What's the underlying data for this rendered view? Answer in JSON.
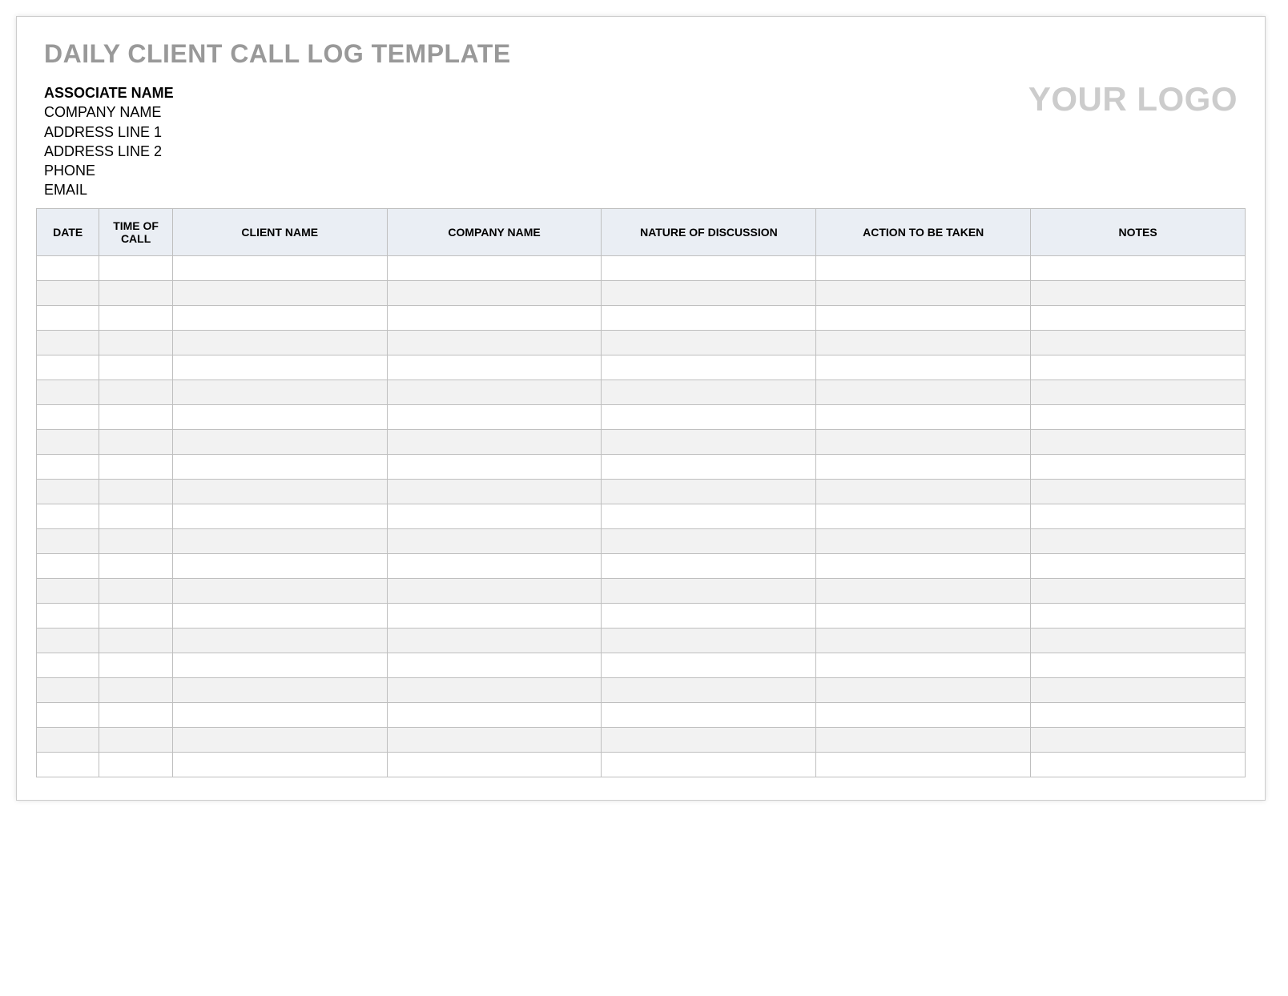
{
  "title": "DAILY CLIENT CALL LOG TEMPLATE",
  "header": {
    "associate_name": "ASSOCIATE NAME",
    "company_name": "COMPANY NAME",
    "address_line_1": "ADDRESS LINE 1",
    "address_line_2": "ADDRESS LINE 2",
    "phone": "PHONE",
    "email": "EMAIL",
    "logo_text": "YOUR LOGO"
  },
  "table": {
    "columns": {
      "date": "DATE",
      "time_of_call": "TIME OF CALL",
      "client_name": "CLIENT NAME",
      "company_name": "COMPANY NAME",
      "nature_of_discussion": "NATURE OF DISCUSSION",
      "action_to_be_taken": "ACTION TO BE TAKEN",
      "notes": "NOTES"
    },
    "rows": [
      {
        "date": "",
        "time_of_call": "",
        "client_name": "",
        "company_name": "",
        "nature_of_discussion": "",
        "action_to_be_taken": "",
        "notes": ""
      },
      {
        "date": "",
        "time_of_call": "",
        "client_name": "",
        "company_name": "",
        "nature_of_discussion": "",
        "action_to_be_taken": "",
        "notes": ""
      },
      {
        "date": "",
        "time_of_call": "",
        "client_name": "",
        "company_name": "",
        "nature_of_discussion": "",
        "action_to_be_taken": "",
        "notes": ""
      },
      {
        "date": "",
        "time_of_call": "",
        "client_name": "",
        "company_name": "",
        "nature_of_discussion": "",
        "action_to_be_taken": "",
        "notes": ""
      },
      {
        "date": "",
        "time_of_call": "",
        "client_name": "",
        "company_name": "",
        "nature_of_discussion": "",
        "action_to_be_taken": "",
        "notes": ""
      },
      {
        "date": "",
        "time_of_call": "",
        "client_name": "",
        "company_name": "",
        "nature_of_discussion": "",
        "action_to_be_taken": "",
        "notes": ""
      },
      {
        "date": "",
        "time_of_call": "",
        "client_name": "",
        "company_name": "",
        "nature_of_discussion": "",
        "action_to_be_taken": "",
        "notes": ""
      },
      {
        "date": "",
        "time_of_call": "",
        "client_name": "",
        "company_name": "",
        "nature_of_discussion": "",
        "action_to_be_taken": "",
        "notes": ""
      },
      {
        "date": "",
        "time_of_call": "",
        "client_name": "",
        "company_name": "",
        "nature_of_discussion": "",
        "action_to_be_taken": "",
        "notes": ""
      },
      {
        "date": "",
        "time_of_call": "",
        "client_name": "",
        "company_name": "",
        "nature_of_discussion": "",
        "action_to_be_taken": "",
        "notes": ""
      },
      {
        "date": "",
        "time_of_call": "",
        "client_name": "",
        "company_name": "",
        "nature_of_discussion": "",
        "action_to_be_taken": "",
        "notes": ""
      },
      {
        "date": "",
        "time_of_call": "",
        "client_name": "",
        "company_name": "",
        "nature_of_discussion": "",
        "action_to_be_taken": "",
        "notes": ""
      },
      {
        "date": "",
        "time_of_call": "",
        "client_name": "",
        "company_name": "",
        "nature_of_discussion": "",
        "action_to_be_taken": "",
        "notes": ""
      },
      {
        "date": "",
        "time_of_call": "",
        "client_name": "",
        "company_name": "",
        "nature_of_discussion": "",
        "action_to_be_taken": "",
        "notes": ""
      },
      {
        "date": "",
        "time_of_call": "",
        "client_name": "",
        "company_name": "",
        "nature_of_discussion": "",
        "action_to_be_taken": "",
        "notes": ""
      },
      {
        "date": "",
        "time_of_call": "",
        "client_name": "",
        "company_name": "",
        "nature_of_discussion": "",
        "action_to_be_taken": "",
        "notes": ""
      },
      {
        "date": "",
        "time_of_call": "",
        "client_name": "",
        "company_name": "",
        "nature_of_discussion": "",
        "action_to_be_taken": "",
        "notes": ""
      },
      {
        "date": "",
        "time_of_call": "",
        "client_name": "",
        "company_name": "",
        "nature_of_discussion": "",
        "action_to_be_taken": "",
        "notes": ""
      },
      {
        "date": "",
        "time_of_call": "",
        "client_name": "",
        "company_name": "",
        "nature_of_discussion": "",
        "action_to_be_taken": "",
        "notes": ""
      },
      {
        "date": "",
        "time_of_call": "",
        "client_name": "",
        "company_name": "",
        "nature_of_discussion": "",
        "action_to_be_taken": "",
        "notes": ""
      },
      {
        "date": "",
        "time_of_call": "",
        "client_name": "",
        "company_name": "",
        "nature_of_discussion": "",
        "action_to_be_taken": "",
        "notes": ""
      }
    ]
  }
}
